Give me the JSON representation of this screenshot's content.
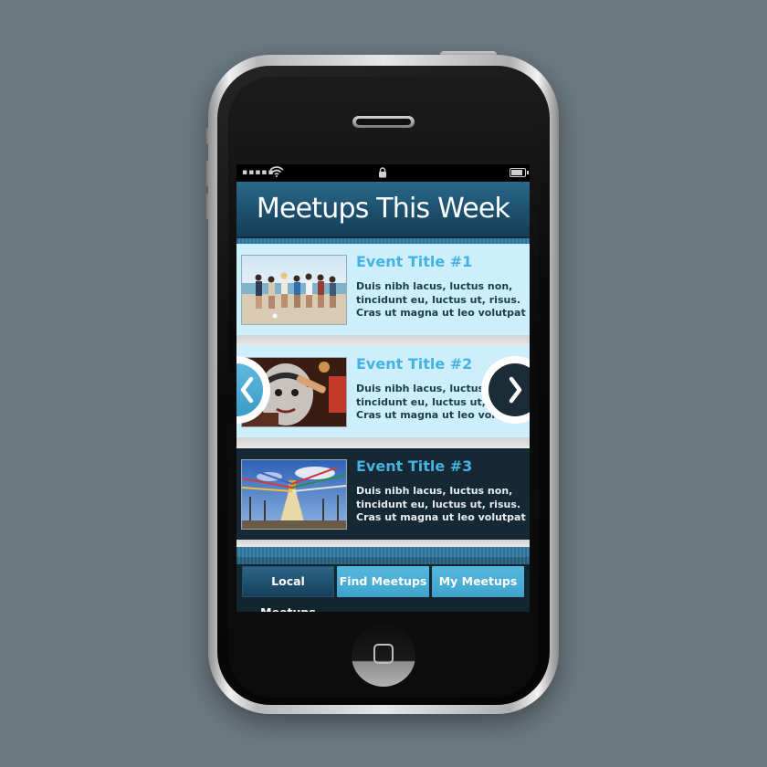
{
  "header": {
    "title": "Meetups This Week"
  },
  "events": [
    {
      "title": "Event Title #1",
      "description": "Duis nibh lacus, luctus non, tincidunt eu, luctus ut, risus. Cras ut magna ut leo volutpat",
      "image": "beach-group-photo"
    },
    {
      "title": "Event Title #2",
      "description": "Duis nibh lacus, luctus non, tincidunt eu, luctus ut, risus. Cras ut magna ut leo volutpat",
      "image": "face-paint-photo"
    },
    {
      "title": "Event Title #3",
      "description": "Duis nibh lacus, luctus non, tincidunt eu, luctus ut, risus. Cras ut magna ut leo volutpat",
      "image": "prayer-flags-photo"
    }
  ],
  "nav": {
    "prev_icon": "chevron-left-icon",
    "next_icon": "chevron-right-icon"
  },
  "tabs": [
    {
      "label": "Local Meetups",
      "active": true
    },
    {
      "label": "Find Meetups",
      "active": false
    },
    {
      "label": "My Meetups",
      "active": false
    }
  ],
  "colors": {
    "header": "#1c4f6c",
    "card_light": "#cdeefb",
    "card_dark": "#162833",
    "title_accent": "#45b2e1",
    "tab_active": "#1e5470",
    "tab_inactive": "#4aaed8",
    "background": "#6b7880"
  }
}
